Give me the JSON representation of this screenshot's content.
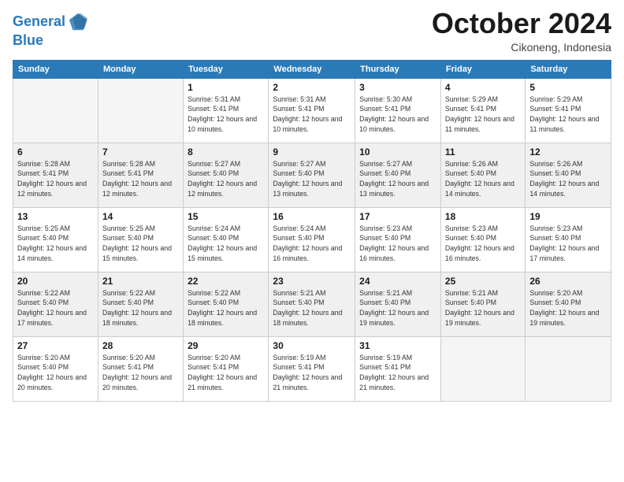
{
  "logo": {
    "line1": "General",
    "line2": "Blue"
  },
  "title": "October 2024",
  "subtitle": "Cikoneng, Indonesia",
  "weekdays": [
    "Sunday",
    "Monday",
    "Tuesday",
    "Wednesday",
    "Thursday",
    "Friday",
    "Saturday"
  ],
  "weeks": [
    [
      {
        "day": "",
        "sunrise": "",
        "sunset": "",
        "daylight": ""
      },
      {
        "day": "",
        "sunrise": "",
        "sunset": "",
        "daylight": ""
      },
      {
        "day": "1",
        "sunrise": "Sunrise: 5:31 AM",
        "sunset": "Sunset: 5:41 PM",
        "daylight": "Daylight: 12 hours and 10 minutes."
      },
      {
        "day": "2",
        "sunrise": "Sunrise: 5:31 AM",
        "sunset": "Sunset: 5:41 PM",
        "daylight": "Daylight: 12 hours and 10 minutes."
      },
      {
        "day": "3",
        "sunrise": "Sunrise: 5:30 AM",
        "sunset": "Sunset: 5:41 PM",
        "daylight": "Daylight: 12 hours and 10 minutes."
      },
      {
        "day": "4",
        "sunrise": "Sunrise: 5:29 AM",
        "sunset": "Sunset: 5:41 PM",
        "daylight": "Daylight: 12 hours and 11 minutes."
      },
      {
        "day": "5",
        "sunrise": "Sunrise: 5:29 AM",
        "sunset": "Sunset: 5:41 PM",
        "daylight": "Daylight: 12 hours and 11 minutes."
      }
    ],
    [
      {
        "day": "6",
        "sunrise": "Sunrise: 5:28 AM",
        "sunset": "Sunset: 5:41 PM",
        "daylight": "Daylight: 12 hours and 12 minutes."
      },
      {
        "day": "7",
        "sunrise": "Sunrise: 5:28 AM",
        "sunset": "Sunset: 5:41 PM",
        "daylight": "Daylight: 12 hours and 12 minutes."
      },
      {
        "day": "8",
        "sunrise": "Sunrise: 5:27 AM",
        "sunset": "Sunset: 5:40 PM",
        "daylight": "Daylight: 12 hours and 12 minutes."
      },
      {
        "day": "9",
        "sunrise": "Sunrise: 5:27 AM",
        "sunset": "Sunset: 5:40 PM",
        "daylight": "Daylight: 12 hours and 13 minutes."
      },
      {
        "day": "10",
        "sunrise": "Sunrise: 5:27 AM",
        "sunset": "Sunset: 5:40 PM",
        "daylight": "Daylight: 12 hours and 13 minutes."
      },
      {
        "day": "11",
        "sunrise": "Sunrise: 5:26 AM",
        "sunset": "Sunset: 5:40 PM",
        "daylight": "Daylight: 12 hours and 14 minutes."
      },
      {
        "day": "12",
        "sunrise": "Sunrise: 5:26 AM",
        "sunset": "Sunset: 5:40 PM",
        "daylight": "Daylight: 12 hours and 14 minutes."
      }
    ],
    [
      {
        "day": "13",
        "sunrise": "Sunrise: 5:25 AM",
        "sunset": "Sunset: 5:40 PM",
        "daylight": "Daylight: 12 hours and 14 minutes."
      },
      {
        "day": "14",
        "sunrise": "Sunrise: 5:25 AM",
        "sunset": "Sunset: 5:40 PM",
        "daylight": "Daylight: 12 hours and 15 minutes."
      },
      {
        "day": "15",
        "sunrise": "Sunrise: 5:24 AM",
        "sunset": "Sunset: 5:40 PM",
        "daylight": "Daylight: 12 hours and 15 minutes."
      },
      {
        "day": "16",
        "sunrise": "Sunrise: 5:24 AM",
        "sunset": "Sunset: 5:40 PM",
        "daylight": "Daylight: 12 hours and 16 minutes."
      },
      {
        "day": "17",
        "sunrise": "Sunrise: 5:23 AM",
        "sunset": "Sunset: 5:40 PM",
        "daylight": "Daylight: 12 hours and 16 minutes."
      },
      {
        "day": "18",
        "sunrise": "Sunrise: 5:23 AM",
        "sunset": "Sunset: 5:40 PM",
        "daylight": "Daylight: 12 hours and 16 minutes."
      },
      {
        "day": "19",
        "sunrise": "Sunrise: 5:23 AM",
        "sunset": "Sunset: 5:40 PM",
        "daylight": "Daylight: 12 hours and 17 minutes."
      }
    ],
    [
      {
        "day": "20",
        "sunrise": "Sunrise: 5:22 AM",
        "sunset": "Sunset: 5:40 PM",
        "daylight": "Daylight: 12 hours and 17 minutes."
      },
      {
        "day": "21",
        "sunrise": "Sunrise: 5:22 AM",
        "sunset": "Sunset: 5:40 PM",
        "daylight": "Daylight: 12 hours and 18 minutes."
      },
      {
        "day": "22",
        "sunrise": "Sunrise: 5:22 AM",
        "sunset": "Sunset: 5:40 PM",
        "daylight": "Daylight: 12 hours and 18 minutes."
      },
      {
        "day": "23",
        "sunrise": "Sunrise: 5:21 AM",
        "sunset": "Sunset: 5:40 PM",
        "daylight": "Daylight: 12 hours and 18 minutes."
      },
      {
        "day": "24",
        "sunrise": "Sunrise: 5:21 AM",
        "sunset": "Sunset: 5:40 PM",
        "daylight": "Daylight: 12 hours and 19 minutes."
      },
      {
        "day": "25",
        "sunrise": "Sunrise: 5:21 AM",
        "sunset": "Sunset: 5:40 PM",
        "daylight": "Daylight: 12 hours and 19 minutes."
      },
      {
        "day": "26",
        "sunrise": "Sunrise: 5:20 AM",
        "sunset": "Sunset: 5:40 PM",
        "daylight": "Daylight: 12 hours and 19 minutes."
      }
    ],
    [
      {
        "day": "27",
        "sunrise": "Sunrise: 5:20 AM",
        "sunset": "Sunset: 5:40 PM",
        "daylight": "Daylight: 12 hours and 20 minutes."
      },
      {
        "day": "28",
        "sunrise": "Sunrise: 5:20 AM",
        "sunset": "Sunset: 5:41 PM",
        "daylight": "Daylight: 12 hours and 20 minutes."
      },
      {
        "day": "29",
        "sunrise": "Sunrise: 5:20 AM",
        "sunset": "Sunset: 5:41 PM",
        "daylight": "Daylight: 12 hours and 21 minutes."
      },
      {
        "day": "30",
        "sunrise": "Sunrise: 5:19 AM",
        "sunset": "Sunset: 5:41 PM",
        "daylight": "Daylight: 12 hours and 21 minutes."
      },
      {
        "day": "31",
        "sunrise": "Sunrise: 5:19 AM",
        "sunset": "Sunset: 5:41 PM",
        "daylight": "Daylight: 12 hours and 21 minutes."
      },
      {
        "day": "",
        "sunrise": "",
        "sunset": "",
        "daylight": ""
      },
      {
        "day": "",
        "sunrise": "",
        "sunset": "",
        "daylight": ""
      }
    ]
  ]
}
